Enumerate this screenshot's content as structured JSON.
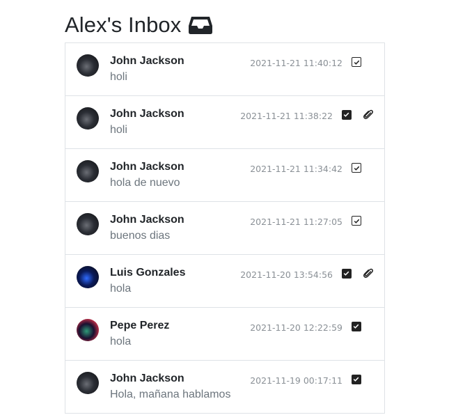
{
  "page": {
    "title": "Alex's Inbox",
    "title_icon": "inbox-icon"
  },
  "messages": [
    {
      "sender": "John Jackson",
      "preview": "holi",
      "date": "2021-11-21 11:40:12",
      "read_checkbox": "outline",
      "has_attachment": false,
      "avatar_colors": [
        "#2b2e35",
        "#6b6e75",
        "#1a1c20"
      ]
    },
    {
      "sender": "John Jackson",
      "preview": "holi",
      "date": "2021-11-21 11:38:22",
      "read_checkbox": "filled",
      "has_attachment": true,
      "avatar_colors": [
        "#2b2e35",
        "#6b6e75",
        "#1a1c20"
      ]
    },
    {
      "sender": "John Jackson",
      "preview": "hola de nuevo",
      "date": "2021-11-21 11:34:42",
      "read_checkbox": "outline",
      "has_attachment": false,
      "avatar_colors": [
        "#2b2e35",
        "#6b6e75",
        "#1a1c20"
      ]
    },
    {
      "sender": "John Jackson",
      "preview": "buenos dias",
      "date": "2021-11-21 11:27:05",
      "read_checkbox": "outline",
      "has_attachment": false,
      "avatar_colors": [
        "#2b2e35",
        "#6b6e75",
        "#1a1c20"
      ]
    },
    {
      "sender": "Luis Gonzales",
      "preview": "hola",
      "date": "2021-11-20 13:54:56",
      "read_checkbox": "filled",
      "has_attachment": true,
      "avatar_colors": [
        "#0a1a5a",
        "#2f6bff",
        "#0b0f2a"
      ]
    },
    {
      "sender": "Pepe Perez",
      "preview": "hola",
      "date": "2021-11-20 12:22:59",
      "read_checkbox": "filled",
      "has_attachment": false,
      "avatar_colors": [
        "#1a1030",
        "#2e9a78",
        "#d0324a"
      ]
    },
    {
      "sender": "John Jackson",
      "preview": "Hola, mañana hablamos",
      "date": "2021-11-19 00:17:11",
      "read_checkbox": "filled",
      "has_attachment": false,
      "avatar_colors": [
        "#2b2e35",
        "#6b6e75",
        "#1a1c20"
      ]
    }
  ],
  "icons": {
    "checkbox": "checkbox-icon",
    "attachment": "paperclip-icon"
  }
}
